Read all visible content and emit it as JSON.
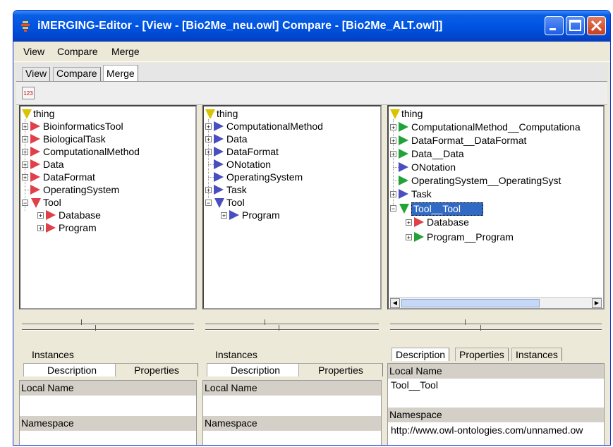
{
  "window": {
    "title": "iMERGING-Editor - [View - [Bio2Me_neu.owl] Compare - [Bio2Me_ALT.owl]]"
  },
  "menu": [
    "View",
    "Compare",
    "Merge"
  ],
  "tabs": [
    "View",
    "Compare",
    "Merge"
  ],
  "toolbar": {
    "button_label": "123"
  },
  "left_tree": {
    "root": "thing",
    "items": [
      {
        "label": "BioinformaticsTool"
      },
      {
        "label": "BiologicalTask"
      },
      {
        "label": "ComputationalMethod"
      },
      {
        "label": "Data"
      },
      {
        "label": "DataFormat"
      },
      {
        "label": "OperatingSystem"
      },
      {
        "label": "Tool"
      },
      {
        "label": "Database"
      },
      {
        "label": "Program"
      }
    ]
  },
  "middle_tree": {
    "root": "thing",
    "items": [
      {
        "label": "ComputationalMethod"
      },
      {
        "label": "Data"
      },
      {
        "label": "DataFormat"
      },
      {
        "label": "ONotation"
      },
      {
        "label": "OperatingSystem"
      },
      {
        "label": "Task"
      },
      {
        "label": "Tool"
      },
      {
        "label": "Program"
      }
    ]
  },
  "right_tree": {
    "root": "thing",
    "items": [
      {
        "label": "ComputationalMethod__Computationa"
      },
      {
        "label": "DataFormat__DataFormat"
      },
      {
        "label": "Data__Data"
      },
      {
        "label": "ONotation"
      },
      {
        "label": "OperatingSystem__OperatingSyst"
      },
      {
        "label": "Task"
      },
      {
        "label": "Tool__Tool"
      },
      {
        "label": "Database"
      },
      {
        "label": "Program__Program"
      }
    ]
  },
  "left_details": {
    "tab_instances": "Instances",
    "tab_description": "Description",
    "tab_properties": "Properties",
    "local_name_label": "Local Name",
    "local_name_value": "",
    "namespace_label": "Namespace",
    "namespace_value": ""
  },
  "middle_details": {
    "tab_instances": "Instances",
    "tab_description": "Description",
    "tab_properties": "Properties",
    "local_name_label": "Local Name",
    "local_name_value": "",
    "namespace_label": "Namespace",
    "namespace_value": ""
  },
  "right_details": {
    "tab_description": "Description",
    "tab_properties": "Properties",
    "tab_instances": "Instances",
    "local_name_label": "Local Name",
    "local_name_value": "Tool__Tool",
    "namespace_label": "Namespace",
    "namespace_value": "http://www.owl-ontologies.com/unnamed.ow"
  },
  "colors": {
    "titlebar": "#0054e3",
    "selection": "#316ac5",
    "class_red": "#e0404a",
    "class_blue": "#4a4fc0",
    "class_green": "#22a33a",
    "root_yellow": "#d8c400"
  }
}
